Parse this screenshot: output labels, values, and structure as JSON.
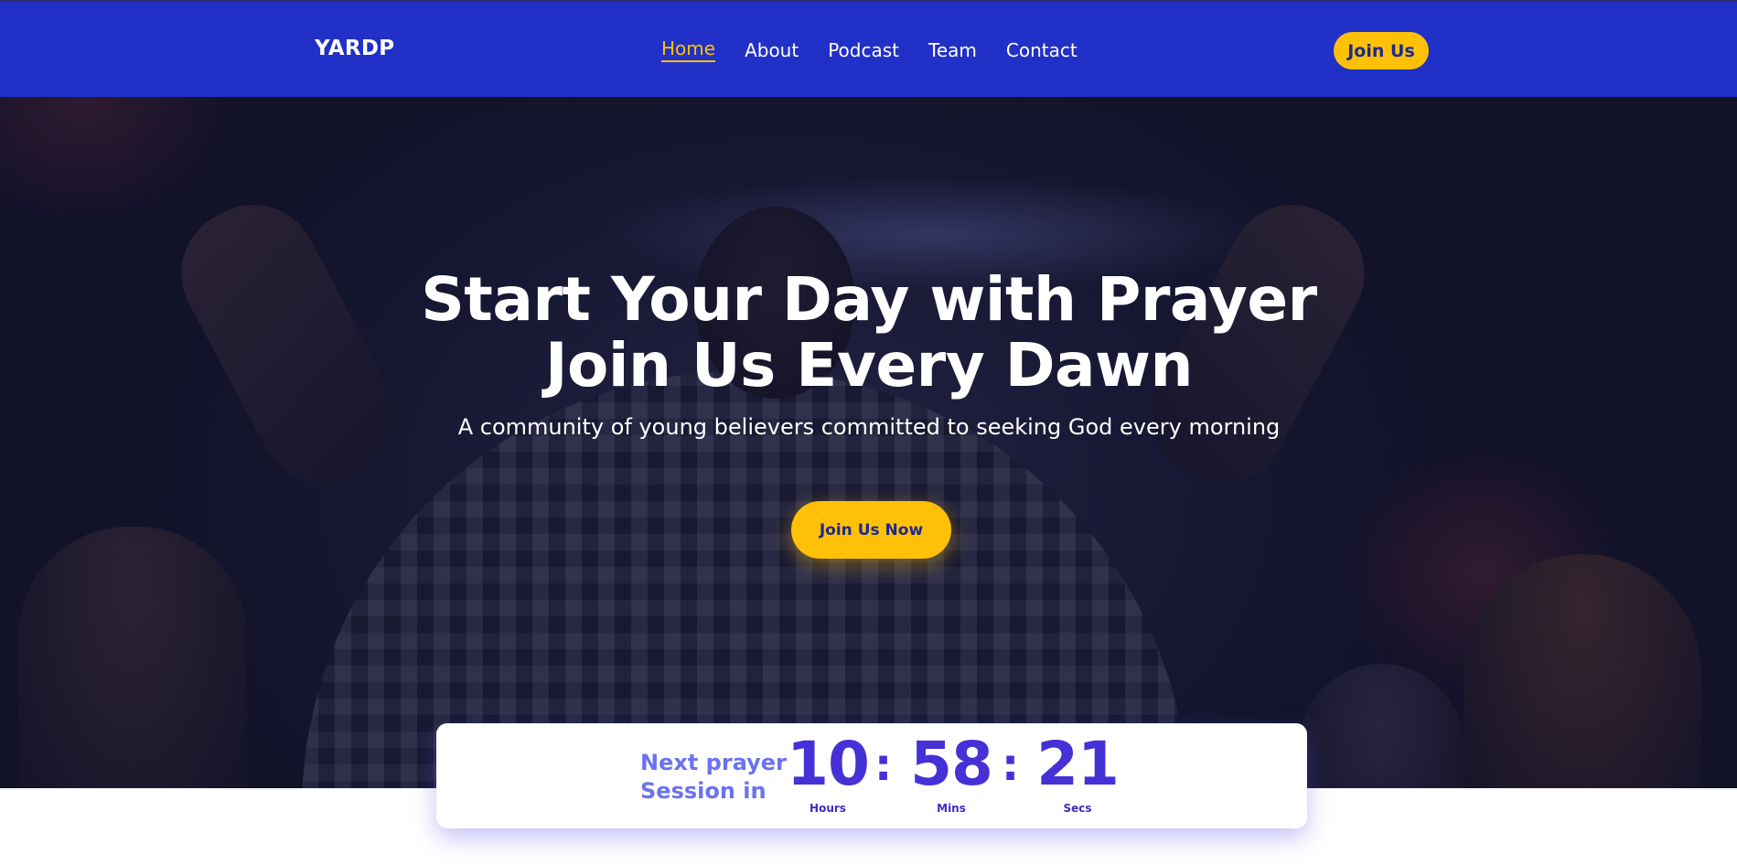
{
  "nav": {
    "logo": "YARDP",
    "links": [
      "Home",
      "About",
      "Podcast",
      "Team",
      "Contact"
    ],
    "active": "Home",
    "join_label": "Join Us"
  },
  "hero": {
    "title": "Start Your Day with Prayer Join Us Every Dawn",
    "subtitle": "A community of young believers committed to seeking God every morning",
    "cta_label": "Join Us Now"
  },
  "countdown": {
    "label": "Next prayer Session in",
    "hours": "10",
    "hours_label": "Hours",
    "mins": "58",
    "mins_label": "Mins",
    "secs": "21",
    "secs_label": "Secs",
    "separator": ":"
  },
  "colors": {
    "nav_bg": "#2130c6",
    "accent": "#ffc107",
    "countdown_number": "#4531d6",
    "countdown_label": "#6b72f0"
  }
}
